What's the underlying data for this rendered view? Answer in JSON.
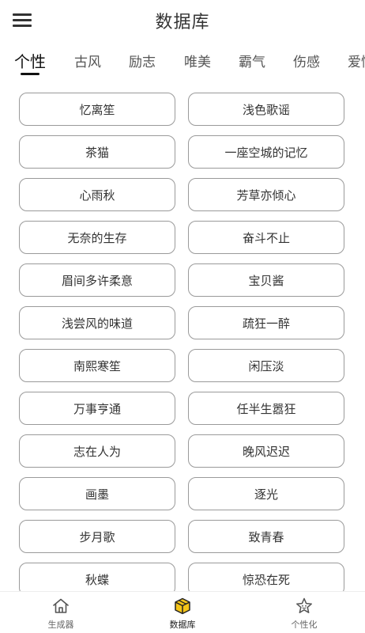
{
  "header": {
    "title": "数据库"
  },
  "tabs": [
    {
      "label": "个性",
      "active": true
    },
    {
      "label": "古风",
      "active": false
    },
    {
      "label": "励志",
      "active": false
    },
    {
      "label": "唯美",
      "active": false
    },
    {
      "label": "霸气",
      "active": false
    },
    {
      "label": "伤感",
      "active": false
    },
    {
      "label": "爱情",
      "active": false
    }
  ],
  "names": [
    "忆离笙",
    "浅色歌谣",
    "茶猫",
    "一座空城的记忆",
    "心雨秋",
    "芳草亦倾心",
    "无奈的生存",
    "奋斗不止",
    "眉间多许柔意",
    "宝贝酱",
    "浅尝风的味道",
    "疏狂一醉",
    "南熙寒笙",
    "闲压淡",
    "万事亨通",
    "任半生嚣狂",
    "志在人为",
    "晚风迟迟",
    "画墨",
    "逐光",
    "步月歌",
    "致青春",
    "秋蝶",
    "惊恐在死"
  ],
  "bottom_nav": [
    {
      "label": "生成器",
      "icon": "home-icon",
      "active": false
    },
    {
      "label": "数据库",
      "icon": "database-box-icon",
      "active": true
    },
    {
      "label": "个性化",
      "icon": "star-face-icon",
      "active": false
    }
  ],
  "colors": {
    "active_icon": "#f5c518",
    "text": "#333333",
    "border": "#9a9a9a"
  }
}
